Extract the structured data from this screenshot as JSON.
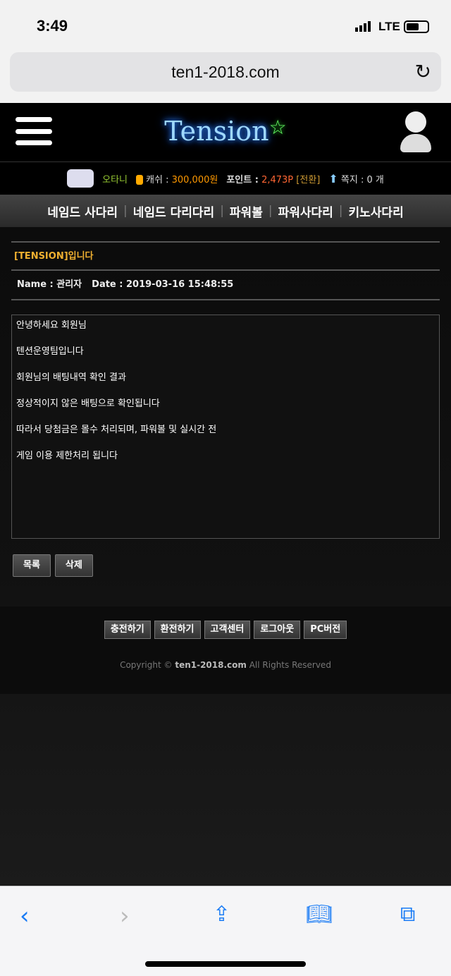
{
  "status": {
    "time": "3:49",
    "network": "LTE"
  },
  "browser": {
    "url": "ten1-2018.com"
  },
  "site": {
    "logo": "Tension",
    "info": {
      "user": "오타니",
      "cash_label": "캐쉬 :",
      "cash": "300,000원",
      "point_label": "포인트 :",
      "point": "2,473P",
      "convert": "[전환]",
      "memo_label": "쪽지 : 0 개"
    },
    "nav": [
      "네임드 사다리",
      "네임드 다리다리",
      "파워볼",
      "파워사다리",
      "키노사다리"
    ],
    "post": {
      "title": "[TENSION]입니다",
      "name": "Name : 관리자",
      "date": "Date : 2019-03-16 15:48:55",
      "lines": [
        "안녕하세요 회원님",
        "텐션운영팀입니다",
        "회원님의 배팅내역 확인 결과",
        "정상적이지 않은 배팅으로 확인됩니다",
        "따라서 당첨금은 몰수 처리되며, 파워볼 및 실시간 전",
        "게임 이용 제한처리 됩니다"
      ]
    },
    "buttons": {
      "list": "목록",
      "delete": "삭제"
    },
    "footer": {
      "buttons": [
        "충전하기",
        "환전하기",
        "고객센터",
        "로그아웃",
        "PC버전"
      ],
      "copy_pre": "Copyright © ",
      "copy_site": "ten1-2018.com",
      "copy_post": " All Rights Reserved"
    }
  }
}
